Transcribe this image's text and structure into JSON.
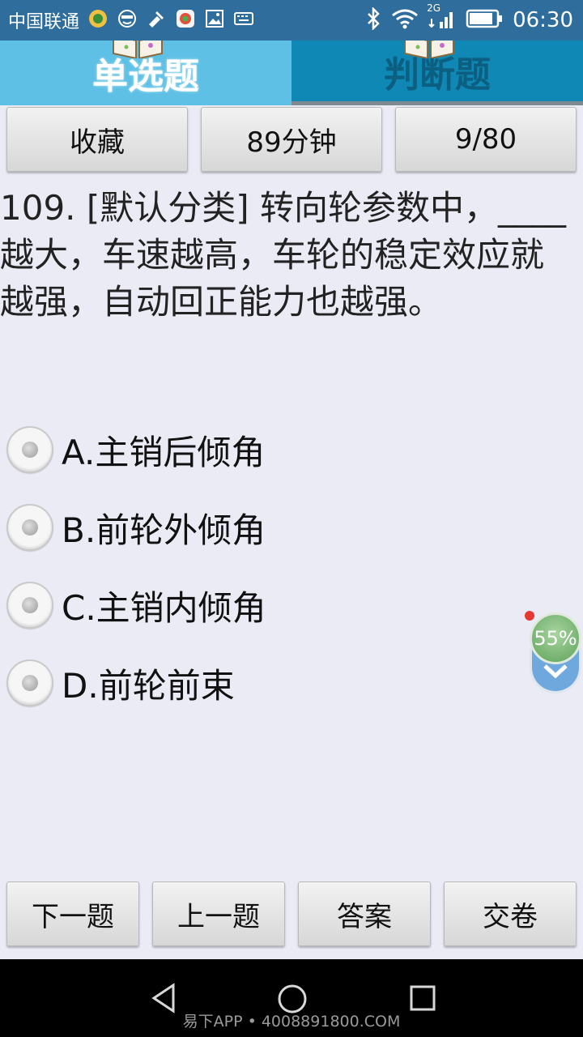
{
  "status_bar": {
    "carrier": "中国联通",
    "network": "2G",
    "time": "06:30"
  },
  "tabs": [
    {
      "label": "单选题",
      "active": true
    },
    {
      "label": "判断题",
      "active": false
    }
  ],
  "top_buttons": {
    "favorite": "收藏",
    "timer": "89分钟",
    "progress": "9/80"
  },
  "question": {
    "text": "109. [默认分类] 转向轮参数中，____越大，车速越高，车轮的稳定效应就越强，自动回正能力也越强。"
  },
  "options": [
    {
      "label": "A.主销后倾角"
    },
    {
      "label": "B.前轮外倾角"
    },
    {
      "label": "C.主销内倾角"
    },
    {
      "label": "D.前轮前束"
    }
  ],
  "floating_widget": {
    "percent": "55%"
  },
  "bottom_buttons": {
    "next": "下一题",
    "prev": "上一题",
    "answer": "答案",
    "submit": "交卷"
  },
  "watermark": "易下APP • 4008891800.COM",
  "colors": {
    "status_bar": "#2e6d9c",
    "tab_active": "#5ec0e5",
    "tab_inactive": "#0f88b6",
    "background": "#ebebf6"
  }
}
